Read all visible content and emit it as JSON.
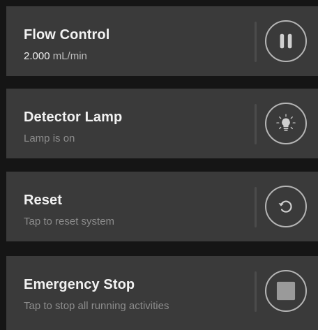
{
  "cards": [
    {
      "title": "Flow Control",
      "subtitle_value": "2.000",
      "subtitle_unit": "mL/min",
      "button_icon": "pause-icon"
    },
    {
      "title": "Detector Lamp",
      "subtitle": "Lamp is on",
      "button_icon": "lightbulb-icon"
    },
    {
      "title": "Reset",
      "subtitle": "Tap to reset system",
      "button_icon": "reset-icon"
    },
    {
      "title": "Emergency Stop",
      "subtitle": "Tap to stop all running activities",
      "button_icon": "stop-icon"
    }
  ],
  "colors": {
    "background": "#151515",
    "card": "#3a3a3a",
    "title": "#f2f2f2",
    "subtitle": "#8c8c8c",
    "icon_stroke": "#b5b5b5"
  }
}
